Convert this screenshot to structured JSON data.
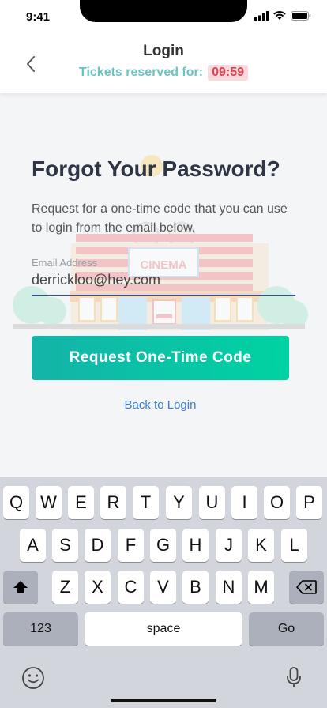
{
  "status_bar": {
    "time": "9:41"
  },
  "header": {
    "title": "Login",
    "subtitle": "Tickets reserved for:",
    "timer": "09:59"
  },
  "illustration": {
    "sign_text": "CINEMA"
  },
  "form": {
    "heading": "Forgot Your Password?",
    "instructions": "Request for a one-time code that you can use to login from the email below.",
    "email_label": "Email Address",
    "email_value": "derrickloo@hey.com",
    "submit_label": "Request One-Time Code",
    "back_link": "Back to Login"
  },
  "keyboard": {
    "row1": [
      "Q",
      "W",
      "E",
      "R",
      "T",
      "Y",
      "U",
      "I",
      "O",
      "P"
    ],
    "row2": [
      "A",
      "S",
      "D",
      "F",
      "G",
      "H",
      "J",
      "K",
      "L"
    ],
    "row3": [
      "Z",
      "X",
      "C",
      "V",
      "B",
      "N",
      "M"
    ],
    "numbers_label": "123",
    "space_label": "space",
    "go_label": "Go"
  }
}
